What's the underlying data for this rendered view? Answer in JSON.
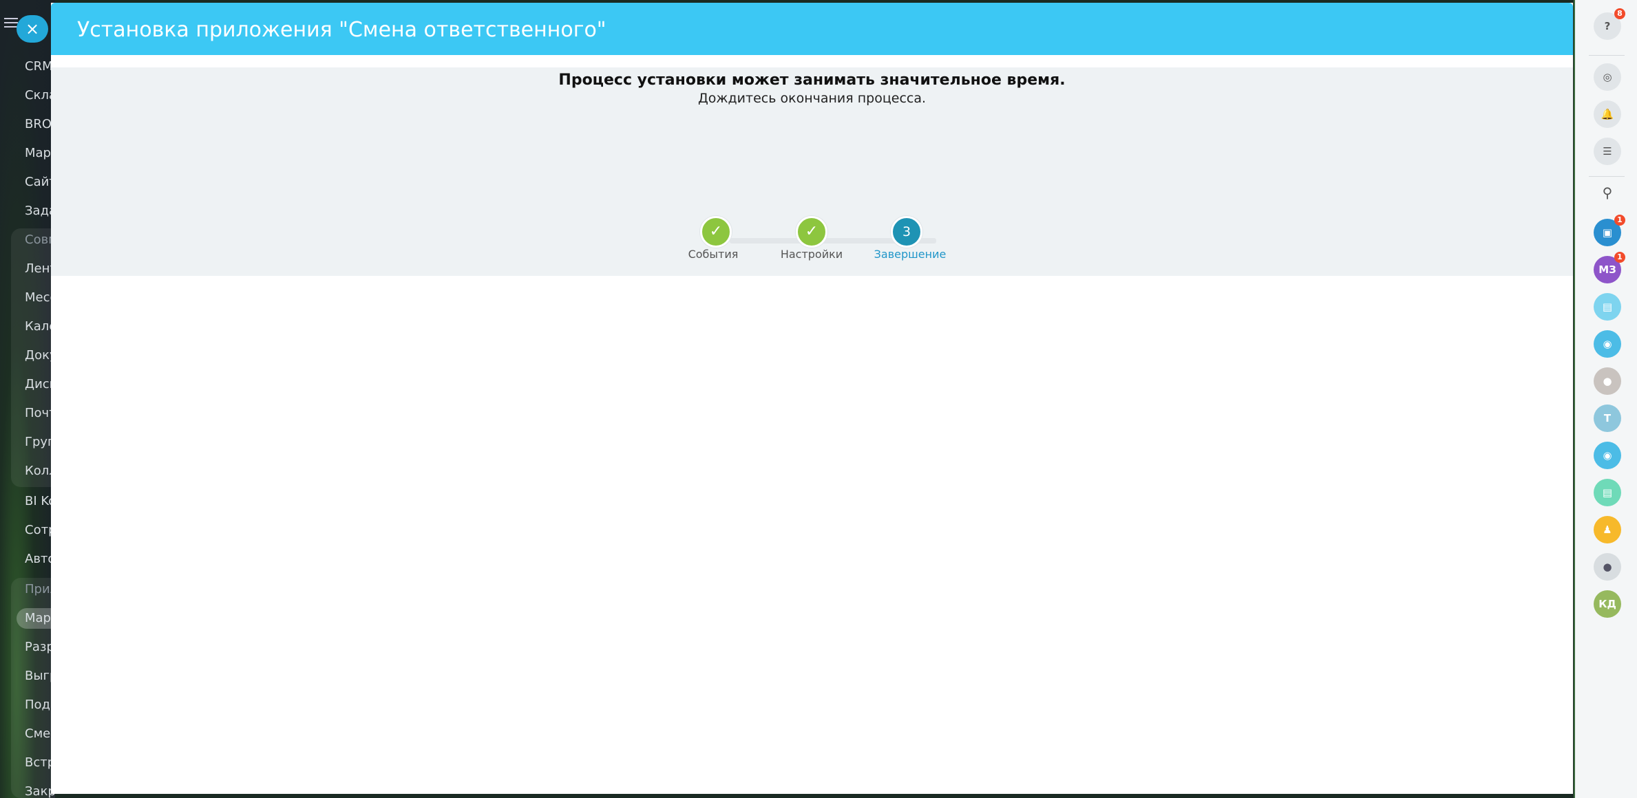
{
  "panel": {
    "title": "Установка приложения \"Смена ответственного\"",
    "close_icon": "close-icon"
  },
  "status": {
    "main": "Процесс установки может занимать значительное время.",
    "sub": "Дождитесь окончания процесса."
  },
  "steps": [
    {
      "label": "События",
      "state": "done",
      "marker": "✓"
    },
    {
      "label": "Настройки",
      "state": "done",
      "marker": "✓"
    },
    {
      "label": "Завершение",
      "state": "current",
      "marker": "3"
    }
  ],
  "left_menu": {
    "items": [
      "CRM",
      "Скла",
      "BROI",
      "Мар",
      "Сайт",
      "Зада",
      "Совм",
      "Лент",
      "Месс",
      "Кале",
      "Доку",
      "Диск",
      "Почт",
      "Груп",
      "Колл",
      "BI Ko",
      "Сотр",
      "Авто",
      "Прил",
      "Мар",
      "Разр",
      "Выгр",
      "Подк",
      "Смен",
      "Встр",
      "Закр"
    ]
  },
  "right_bar": {
    "help_badge": "8",
    "chat_badge_1": "1",
    "chat_badge_2": "1",
    "avatar_mz": "МЗ",
    "avatar_t": "Т",
    "avatar_kd": "КД"
  },
  "colors": {
    "header": "#3cc8f4",
    "done": "#8dc63f",
    "current": "#1e93b4"
  }
}
